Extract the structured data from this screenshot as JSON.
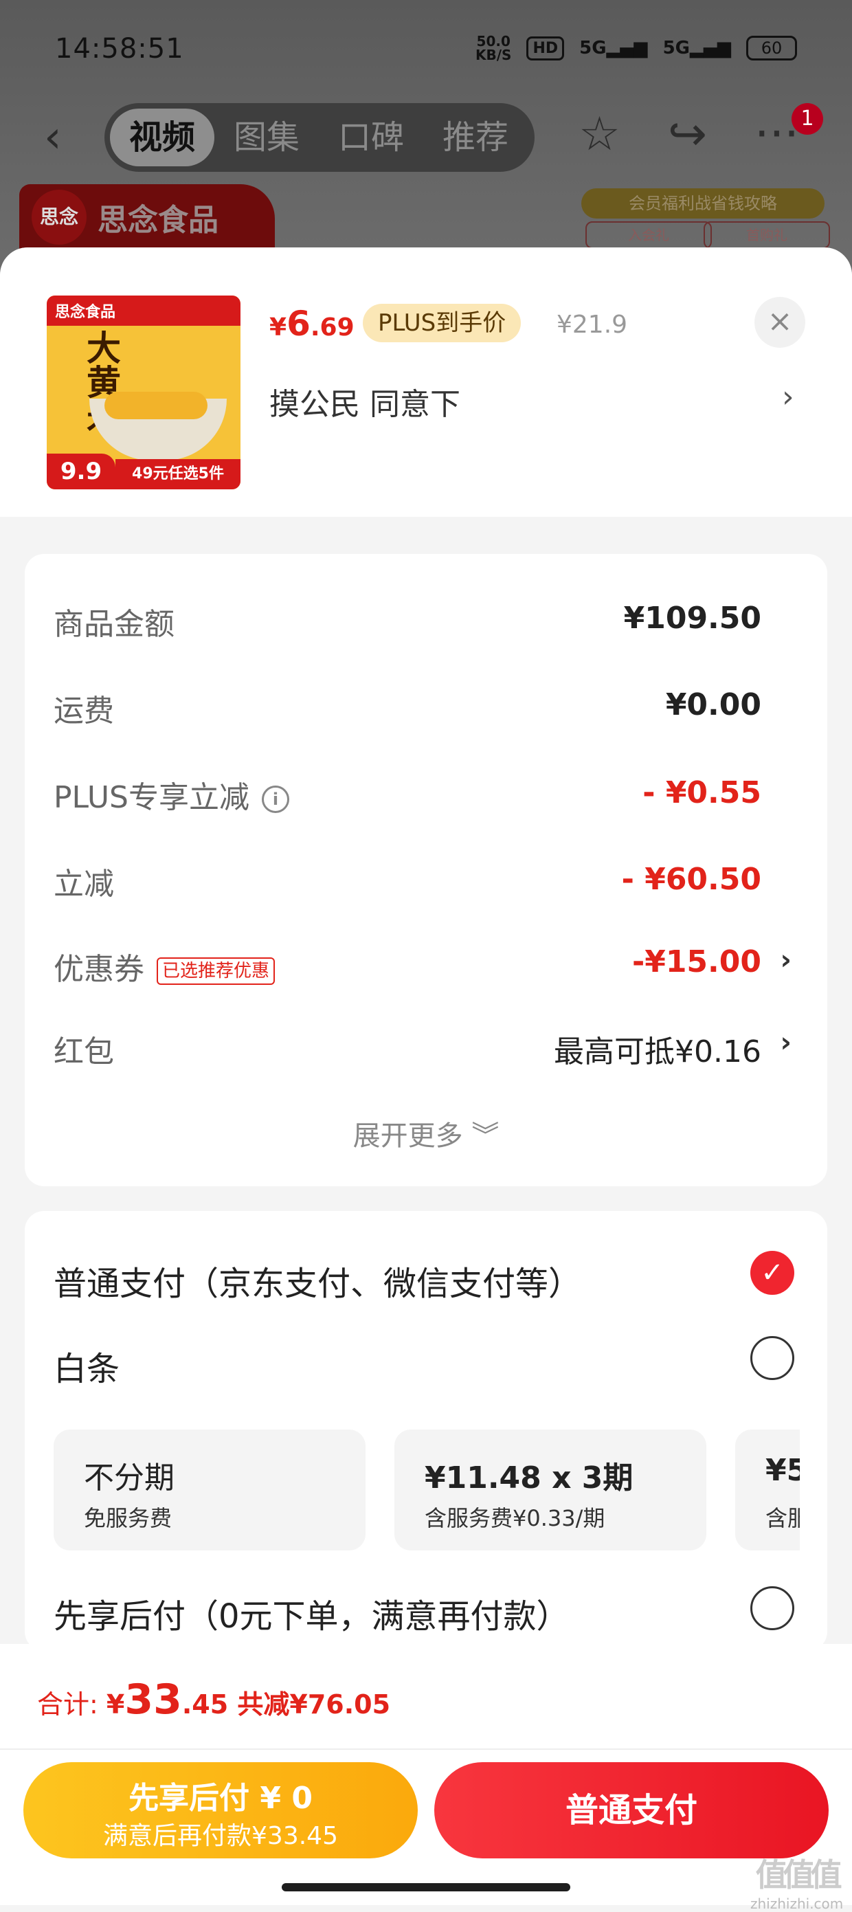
{
  "status_bar": {
    "time": "14:58:51",
    "net_speed": "50.0",
    "net_unit": "KB/S",
    "hd": "HD",
    "sig1": "5G",
    "sig2": "5G",
    "battery": "60"
  },
  "header": {
    "back": "‹",
    "tabs": [
      {
        "label": "视频",
        "active": true
      },
      {
        "label": "图集"
      },
      {
        "label": "口碑"
      },
      {
        "label": "推荐"
      }
    ],
    "star": "☆",
    "share": "↪",
    "more": "···",
    "badge": "1",
    "brand_logo": "思念",
    "brand_name": "思念食品",
    "promo_title": "会员福利战省钱攻略",
    "promo_sub1": "入会礼",
    "promo_sub2": "首购礼"
  },
  "product": {
    "image": {
      "brand": "思念食品",
      "title": "大黄米",
      "price_tag": "9.9",
      "deal": "49元任选5件"
    },
    "price_symbol": "¥",
    "price_int": "6",
    "price_dec": ".69",
    "plus_tag": "PLUS到手价",
    "original_price": "¥21.9",
    "close": "×",
    "spec": "摸公民  同意下",
    "spec_arrow": "›"
  },
  "summary": {
    "rows": [
      {
        "label": "商品金额",
        "value": "¥109.50"
      },
      {
        "label": "运费",
        "value": "¥0.00"
      },
      {
        "label": "PLUS专享立减",
        "info": "i",
        "value": "- ¥0.55"
      },
      {
        "label": "立减",
        "value": "- ¥60.50"
      },
      {
        "label": "优惠券",
        "tag": "已选推荐优惠",
        "value": "-¥15.00",
        "chevron": "›"
      },
      {
        "label": "红包",
        "value": "最高可抵¥0.16",
        "chevron": "›"
      }
    ],
    "expand": "展开更多 ︾"
  },
  "payment": {
    "normal": {
      "label": "普通支付（京东支付、微信支付等）",
      "check": "✓"
    },
    "baitiao": {
      "label": "白条"
    },
    "installments": [
      {
        "main": "不分期",
        "sub": "免服务费"
      },
      {
        "main": "¥11.48 x 3期",
        "sub": "含服务费¥0.33/期"
      },
      {
        "main": "¥5",
        "sub": "含服"
      }
    ],
    "later": {
      "label": "先享后付（0元下单，满意再付款）"
    }
  },
  "footer": {
    "total_label": "合计: ",
    "total_symbol": "¥",
    "total_int": "33",
    "total_dec": ".45",
    "saved": " 共减¥76.05",
    "later_btn_title": "先享后付 ¥ 0",
    "later_btn_sub": "满意后再付款¥33.45",
    "pay_btn": "普通支付",
    "watermark_big": "值值值",
    "watermark_small": "zhizhizhi.com"
  },
  "colors": {
    "accent_red": "#e2231a",
    "pay_red": "#f0252f",
    "later_yellow": "#fdc51f"
  }
}
